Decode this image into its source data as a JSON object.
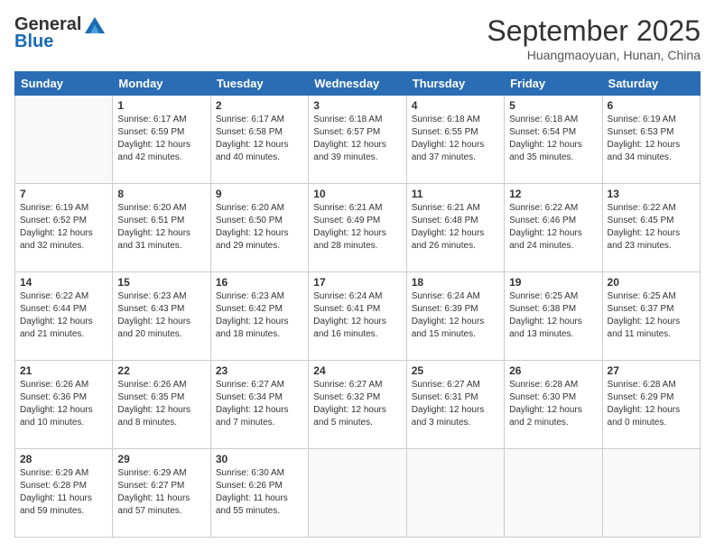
{
  "header": {
    "logo_line1": "General",
    "logo_line2": "Blue",
    "month": "September 2025",
    "location": "Huangmaoyuan, Hunan, China"
  },
  "days_of_week": [
    "Sunday",
    "Monday",
    "Tuesday",
    "Wednesday",
    "Thursday",
    "Friday",
    "Saturday"
  ],
  "weeks": [
    [
      {
        "day": "",
        "info": ""
      },
      {
        "day": "1",
        "info": "Sunrise: 6:17 AM\nSunset: 6:59 PM\nDaylight: 12 hours\nand 42 minutes."
      },
      {
        "day": "2",
        "info": "Sunrise: 6:17 AM\nSunset: 6:58 PM\nDaylight: 12 hours\nand 40 minutes."
      },
      {
        "day": "3",
        "info": "Sunrise: 6:18 AM\nSunset: 6:57 PM\nDaylight: 12 hours\nand 39 minutes."
      },
      {
        "day": "4",
        "info": "Sunrise: 6:18 AM\nSunset: 6:55 PM\nDaylight: 12 hours\nand 37 minutes."
      },
      {
        "day": "5",
        "info": "Sunrise: 6:18 AM\nSunset: 6:54 PM\nDaylight: 12 hours\nand 35 minutes."
      },
      {
        "day": "6",
        "info": "Sunrise: 6:19 AM\nSunset: 6:53 PM\nDaylight: 12 hours\nand 34 minutes."
      }
    ],
    [
      {
        "day": "7",
        "info": "Sunrise: 6:19 AM\nSunset: 6:52 PM\nDaylight: 12 hours\nand 32 minutes."
      },
      {
        "day": "8",
        "info": "Sunrise: 6:20 AM\nSunset: 6:51 PM\nDaylight: 12 hours\nand 31 minutes."
      },
      {
        "day": "9",
        "info": "Sunrise: 6:20 AM\nSunset: 6:50 PM\nDaylight: 12 hours\nand 29 minutes."
      },
      {
        "day": "10",
        "info": "Sunrise: 6:21 AM\nSunset: 6:49 PM\nDaylight: 12 hours\nand 28 minutes."
      },
      {
        "day": "11",
        "info": "Sunrise: 6:21 AM\nSunset: 6:48 PM\nDaylight: 12 hours\nand 26 minutes."
      },
      {
        "day": "12",
        "info": "Sunrise: 6:22 AM\nSunset: 6:46 PM\nDaylight: 12 hours\nand 24 minutes."
      },
      {
        "day": "13",
        "info": "Sunrise: 6:22 AM\nSunset: 6:45 PM\nDaylight: 12 hours\nand 23 minutes."
      }
    ],
    [
      {
        "day": "14",
        "info": "Sunrise: 6:22 AM\nSunset: 6:44 PM\nDaylight: 12 hours\nand 21 minutes."
      },
      {
        "day": "15",
        "info": "Sunrise: 6:23 AM\nSunset: 6:43 PM\nDaylight: 12 hours\nand 20 minutes."
      },
      {
        "day": "16",
        "info": "Sunrise: 6:23 AM\nSunset: 6:42 PM\nDaylight: 12 hours\nand 18 minutes."
      },
      {
        "day": "17",
        "info": "Sunrise: 6:24 AM\nSunset: 6:41 PM\nDaylight: 12 hours\nand 16 minutes."
      },
      {
        "day": "18",
        "info": "Sunrise: 6:24 AM\nSunset: 6:39 PM\nDaylight: 12 hours\nand 15 minutes."
      },
      {
        "day": "19",
        "info": "Sunrise: 6:25 AM\nSunset: 6:38 PM\nDaylight: 12 hours\nand 13 minutes."
      },
      {
        "day": "20",
        "info": "Sunrise: 6:25 AM\nSunset: 6:37 PM\nDaylight: 12 hours\nand 11 minutes."
      }
    ],
    [
      {
        "day": "21",
        "info": "Sunrise: 6:26 AM\nSunset: 6:36 PM\nDaylight: 12 hours\nand 10 minutes."
      },
      {
        "day": "22",
        "info": "Sunrise: 6:26 AM\nSunset: 6:35 PM\nDaylight: 12 hours\nand 8 minutes."
      },
      {
        "day": "23",
        "info": "Sunrise: 6:27 AM\nSunset: 6:34 PM\nDaylight: 12 hours\nand 7 minutes."
      },
      {
        "day": "24",
        "info": "Sunrise: 6:27 AM\nSunset: 6:32 PM\nDaylight: 12 hours\nand 5 minutes."
      },
      {
        "day": "25",
        "info": "Sunrise: 6:27 AM\nSunset: 6:31 PM\nDaylight: 12 hours\nand 3 minutes."
      },
      {
        "day": "26",
        "info": "Sunrise: 6:28 AM\nSunset: 6:30 PM\nDaylight: 12 hours\nand 2 minutes."
      },
      {
        "day": "27",
        "info": "Sunrise: 6:28 AM\nSunset: 6:29 PM\nDaylight: 12 hours\nand 0 minutes."
      }
    ],
    [
      {
        "day": "28",
        "info": "Sunrise: 6:29 AM\nSunset: 6:28 PM\nDaylight: 11 hours\nand 59 minutes."
      },
      {
        "day": "29",
        "info": "Sunrise: 6:29 AM\nSunset: 6:27 PM\nDaylight: 11 hours\nand 57 minutes."
      },
      {
        "day": "30",
        "info": "Sunrise: 6:30 AM\nSunset: 6:26 PM\nDaylight: 11 hours\nand 55 minutes."
      },
      {
        "day": "",
        "info": ""
      },
      {
        "day": "",
        "info": ""
      },
      {
        "day": "",
        "info": ""
      },
      {
        "day": "",
        "info": ""
      }
    ]
  ]
}
